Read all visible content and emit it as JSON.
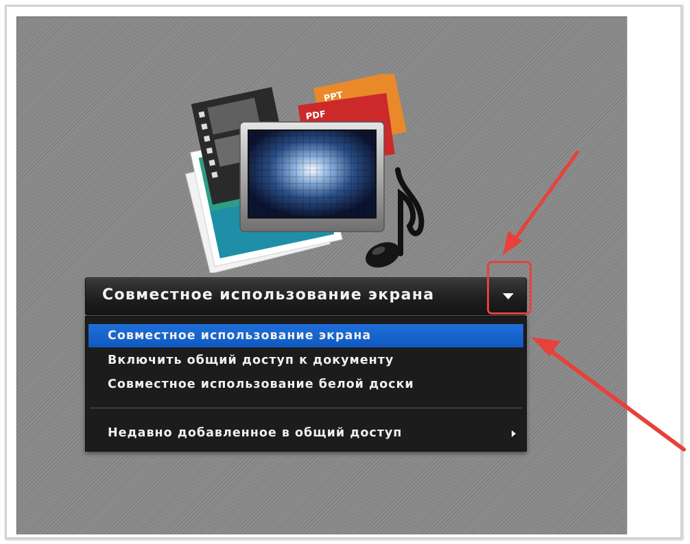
{
  "share_select": {
    "current_value": "Совместное использование экрана"
  },
  "dropdown_menu": {
    "items": [
      {
        "label": "Совместное использование экрана",
        "selected": true
      },
      {
        "label": "Включить общий доступ к документу",
        "selected": false
      },
      {
        "label": "Совместное использование белой доски",
        "selected": false
      }
    ],
    "recent": {
      "label": "Недавно добавленное в общий доступ"
    }
  },
  "content_icon": {
    "doc_tabs": [
      "PPT",
      "PDF"
    ]
  },
  "colors": {
    "stage_background": "#8d8d8d",
    "menu_background": "#1c1c1c",
    "selection_blue": "#1862cc",
    "annotation_red": "#e8413b"
  },
  "icons": [
    "content-share-icon",
    "chevron-down-icon",
    "chevron-right-icon",
    "annotation-arrow",
    "annotation-highlight-box"
  ]
}
